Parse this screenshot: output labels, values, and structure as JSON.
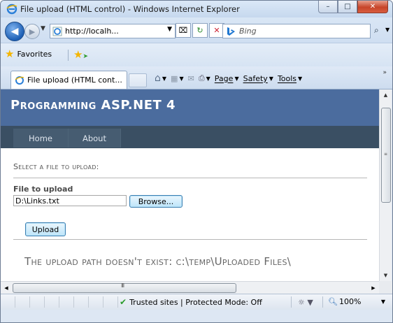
{
  "window": {
    "title": "File upload (HTML control) - Windows Internet Explorer",
    "controls": {
      "minimize": "–",
      "maximize": "□",
      "close": "✕"
    }
  },
  "toolbar": {
    "url": "http://localh...",
    "search_placeholder": "Bing",
    "search_go": "⌕"
  },
  "favorites": {
    "label": "Favorites"
  },
  "tab": {
    "label": "File upload (HTML cont..."
  },
  "commands": [
    {
      "label": "Page"
    },
    {
      "label": "Safety"
    },
    {
      "label": "Tools"
    }
  ],
  "page": {
    "site_title": "Programming ASP.NET 4",
    "nav": [
      {
        "label": "Home"
      },
      {
        "label": "About"
      }
    ],
    "section_heading": "Select a file to upload:",
    "file_label": "File to upload",
    "file_value": "D:\\Links.txt",
    "browse_label": "Browse...",
    "upload_label": "Upload",
    "message": "The upload path doesn't exist: c:\\temp\\Uploaded Files\\"
  },
  "status": {
    "zone": "Trusted sites | Protected Mode: Off",
    "zoom": "100%"
  },
  "scrollbar": {
    "h_grip": "III",
    "v_grip": "≡"
  },
  "colors": {
    "header_bg": "#4b6c9e",
    "nav_bg": "#3a4f63",
    "nav_item_bg": "#465c71"
  }
}
